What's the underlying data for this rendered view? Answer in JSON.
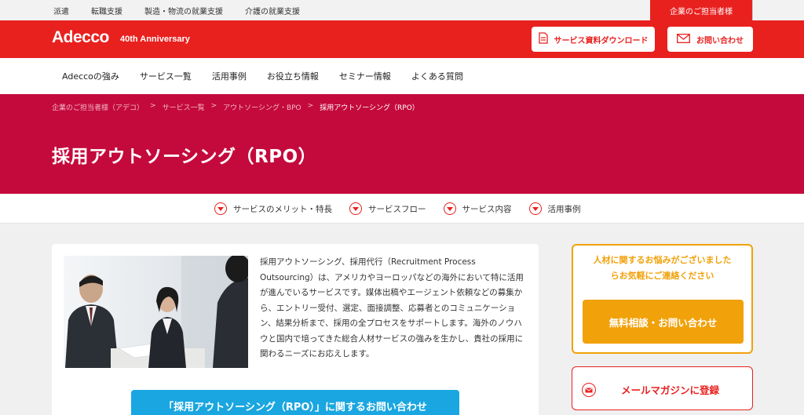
{
  "topbar": {
    "links": [
      "派遣",
      "転職支援",
      "製造・物流の就業支援",
      "介護の就業支援"
    ],
    "corporate_tab": "企業のご担当者様"
  },
  "header": {
    "logo": "Adecco",
    "anniversary": "40th Anniversary",
    "download_label": "サービス資料ダウンロード",
    "contact_label": "お問い合わせ",
    "brand_color": "#e8211f"
  },
  "nav": {
    "items": [
      "Adeccoの強み",
      "サービス一覧",
      "活用事例",
      "お役立ち情報",
      "セミナー情報",
      "よくある質問"
    ]
  },
  "breadcrumb": [
    "企業のご担当者様（アデコ）",
    "サービス一覧",
    "アウトソーシング・BPO",
    "採用アウトソーシング（RPO）"
  ],
  "hero": {
    "title": "採用アウトソーシング（RPO）",
    "color": "#c40a3c"
  },
  "anchors": [
    "サービスのメリット・特長",
    "サービスフロー",
    "サービス内容",
    "活用事例"
  ],
  "main": {
    "description": "採用アウトソーシング、採用代行（Recruitment Process Outsourcing）は、アメリカやヨーロッパなどの海外において特に活用が進んでいるサービスです。媒体出稿やエージェント依頼などの募集から、エントリー受付、選定、面接調整、応募者とのコミュニケーション、結果分析まで、採用の全プロセスをサポートします。海外のノウハウと国内で培ってきた総合人材サービスの強みを生かし、貴社の採用に関わるニーズにお応えします。",
    "cta_label": "「採用アウトソーシング（RPO）」に関するお問い合わせ"
  },
  "sidebar": {
    "message_line1": "人材に関するお悩みがございました",
    "message_line2": "らお気軽にご連絡ください",
    "consult_button": "無料相談・お問い合わせ",
    "newsletter_button": "メールマガジンに登録",
    "accent_color": "#f1a10a"
  }
}
